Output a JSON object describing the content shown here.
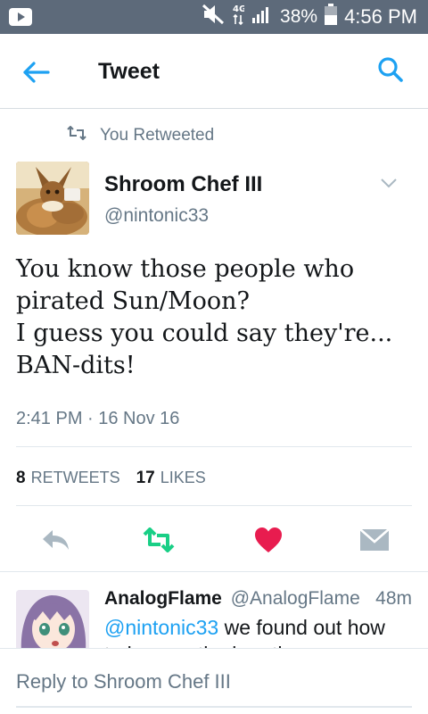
{
  "status_bar": {
    "battery_percent": "38%",
    "time": "4:56 PM",
    "background_color": "#5d6a7a"
  },
  "app_bar": {
    "title": "Tweet",
    "accent_color": "#1da1f2"
  },
  "tweet": {
    "retweet_label": "You Retweeted",
    "author_name": "Shroom Chef III",
    "author_handle": "@nintonic33",
    "text_lines": [
      "You know those people who",
      "pirated Sun/Moon?",
      "I guess you could say they're...",
      "BAN-dits!"
    ],
    "timestamp": "2:41 PM · 16 Nov 16",
    "retweets_count": "8",
    "retweets_label": "RETWEETS",
    "likes_count": "17",
    "likes_label": "LIKES",
    "retweeted_color": "#19cf86",
    "liked_color": "#e81c4f"
  },
  "reply": {
    "author_name": "AnalogFlame",
    "author_handle": "@AnalogFlame",
    "time": "48m",
    "mention": "@nintonic33",
    "text": " we found out how",
    "text_line_2": "to bypass the ban tho"
  },
  "reply_bar": {
    "placeholder": "Reply to Shroom Chef III"
  }
}
